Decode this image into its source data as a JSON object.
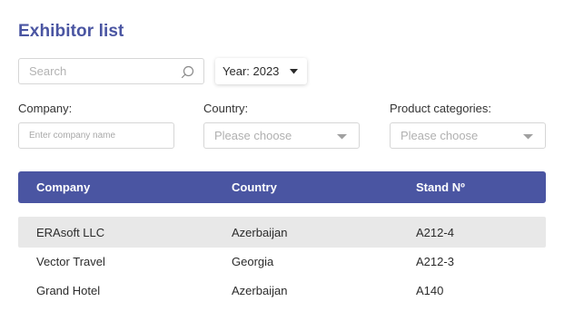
{
  "page": {
    "title": "Exhibitor list"
  },
  "search": {
    "placeholder": "Search"
  },
  "year_filter": {
    "label": "Year: 2023"
  },
  "filters": {
    "company": {
      "label": "Company:",
      "placeholder": "Enter company name"
    },
    "country": {
      "label": "Country:",
      "value": "Please choose"
    },
    "categories": {
      "label": "Product categories:",
      "value": "Please choose"
    }
  },
  "table": {
    "columns": [
      "Company",
      "Country",
      "Stand Nº"
    ],
    "rows": [
      {
        "company": "ERAsoft LLC",
        "country": "Azerbaijan",
        "stand": "A212-4"
      },
      {
        "company": "Vector Travel",
        "country": "Georgia",
        "stand": "A212-3"
      },
      {
        "company": "Grand Hotel",
        "country": "Azerbaijan",
        "stand": "A140"
      }
    ]
  },
  "colors": {
    "accent": "#4a55a2",
    "row_highlight": "#e8e8e8",
    "border": "#d6d6d6"
  },
  "icons": {
    "search": "search-icon",
    "dropdown": "chevron-down-icon"
  }
}
